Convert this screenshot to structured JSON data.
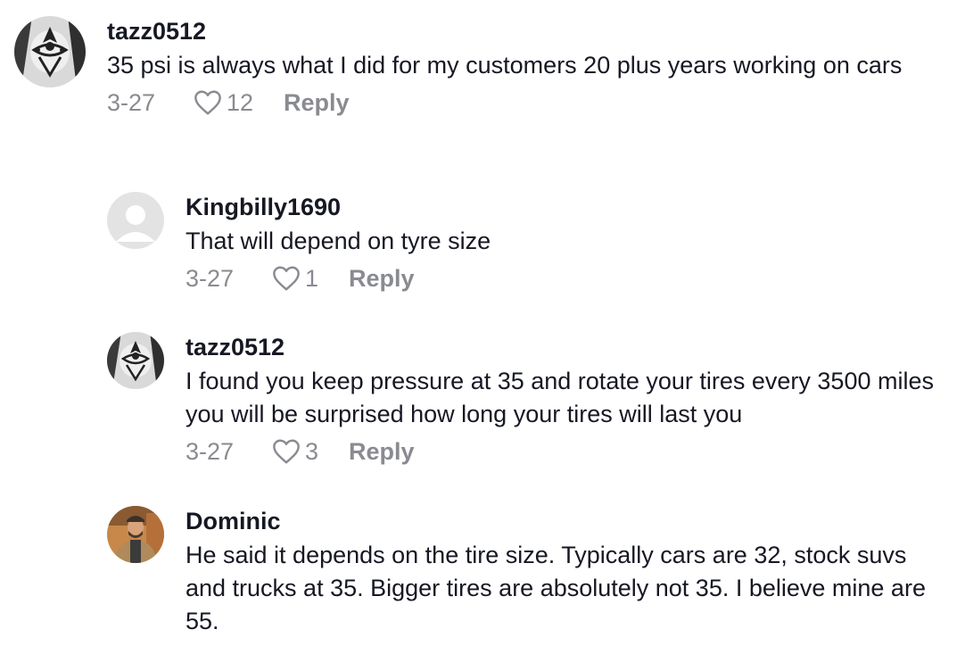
{
  "comments": [
    {
      "username": "tazz0512",
      "text": "35 psi is always what I did for my customers 20 plus years working on cars",
      "date": "3-27",
      "likes": "12",
      "reply_label": "Reply"
    },
    {
      "username": "Kingbilly1690",
      "text": "That will depend on tyre size",
      "date": "3-27",
      "likes": "1",
      "reply_label": "Reply"
    },
    {
      "username": "tazz0512",
      "text": "I found you keep pressure at 35 and rotate your tires every 3500 miles you will be surprised how long your tires will last you",
      "date": "3-27",
      "likes": "3",
      "reply_label": "Reply"
    },
    {
      "username": "Dominic",
      "text": "He said it depends on the tire size. Typically cars are 32, stock suvs and trucks at 35. Bigger tires are absolutely not 35. I believe mine are 55."
    }
  ],
  "icons": {
    "like": "heart-outline-icon",
    "default_avatar": "default-user-avatar"
  },
  "colors": {
    "text_primary": "#161823",
    "text_secondary": "#8a8b91"
  }
}
